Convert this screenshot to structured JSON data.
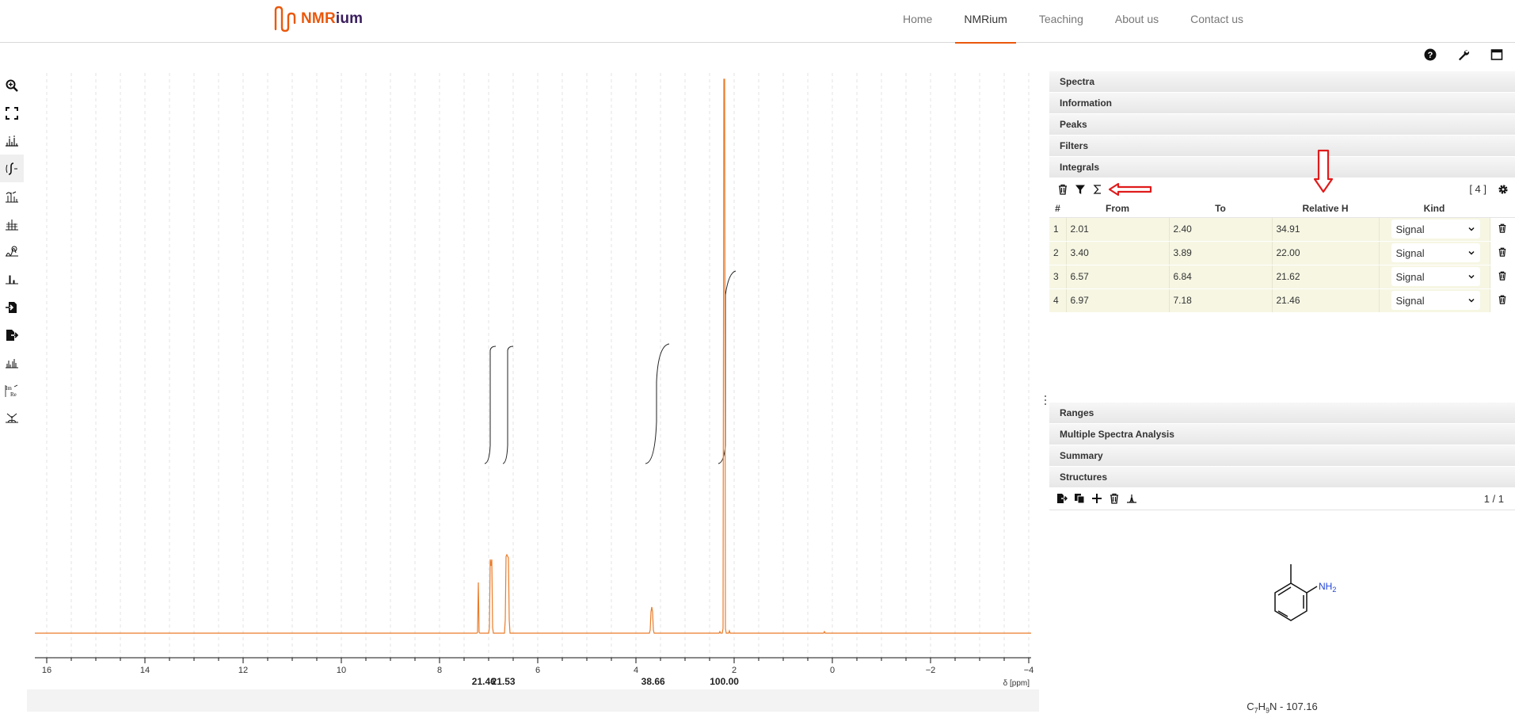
{
  "nav": {
    "logo": "NMRium",
    "links": [
      "Home",
      "NMRium",
      "Teaching",
      "About us",
      "Contact us"
    ],
    "active": "NMRium"
  },
  "topright_icons": [
    "help-icon",
    "wrench-icon",
    "window-icon"
  ],
  "toolbar_icons": [
    "zoom-icon",
    "fit-icon",
    "peak-picking-icon",
    "integral-tool-icon",
    "zone-picking-icon",
    "range-picking-icon",
    "baseline-icon",
    "phase-icon",
    "import-icon",
    "export-icon",
    "multiplet-icon",
    "real-imaginary-icon",
    "apodization-icon"
  ],
  "toolbar_labels": {
    "real_imag": "Im Re"
  },
  "spectrum": {
    "axis_unit": "δ [ppm]",
    "x_ticks": [
      "16",
      "14",
      "12",
      "10",
      "8",
      "6",
      "4",
      "2",
      "0",
      "−2",
      "−4"
    ],
    "integral_labels": [
      {
        "ppm": 7.1,
        "text": "21.46"
      },
      {
        "ppm": 6.7,
        "text": "21.53"
      },
      {
        "ppm": 3.65,
        "text": "38.66"
      },
      {
        "ppm": 2.2,
        "text": "100.00"
      }
    ],
    "color": "#ea7c2a"
  },
  "panel": {
    "sections_top": [
      "Spectra",
      "Information",
      "Peaks",
      "Filters",
      "Integrals"
    ],
    "integrals": {
      "count": "[ 4 ]",
      "columns": [
        "#",
        "From",
        "To",
        "Relative H",
        "Kind"
      ],
      "rows": [
        {
          "n": "1",
          "from": "2.01",
          "to": "2.40",
          "rel": "34.91",
          "kind": "Signal"
        },
        {
          "n": "2",
          "from": "3.40",
          "to": "3.89",
          "rel": "22.00",
          "kind": "Signal"
        },
        {
          "n": "3",
          "from": "6.57",
          "to": "6.84",
          "rel": "21.62",
          "kind": "Signal"
        },
        {
          "n": "4",
          "from": "6.97",
          "to": "7.18",
          "rel": "21.46",
          "kind": "Signal"
        }
      ]
    },
    "sections_bottom": [
      "Ranges",
      "Multiple Spectra Analysis",
      "Summary",
      "Structures"
    ],
    "structures": {
      "page": "1 / 1",
      "atom_label": "NH",
      "atom_sub": "2",
      "formula": {
        "c": "C",
        "c_n": "7",
        "h": "H",
        "h_n": "9",
        "rest": "N - 107.16"
      }
    }
  }
}
